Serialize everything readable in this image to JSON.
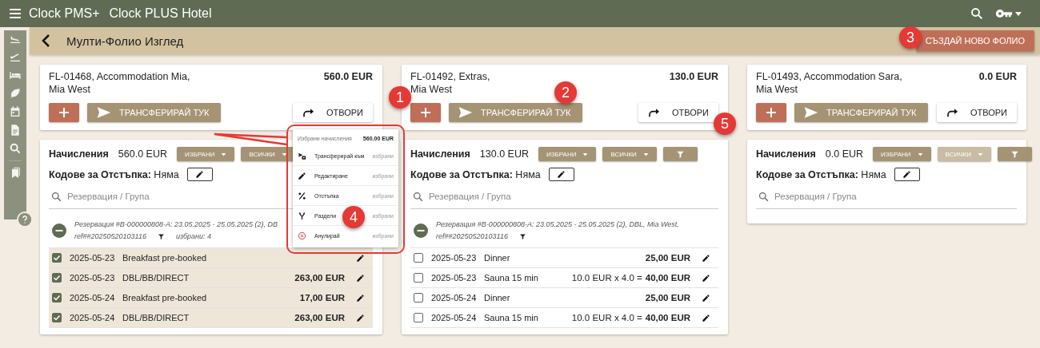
{
  "topbar": {
    "brand": "Clock PMS+",
    "hotel": "Clock PLUS Hotel"
  },
  "subheader": {
    "title": "Мулти-Фолио Изглед",
    "create_button": "СЪЗДАЙ НОВО ФОЛИО"
  },
  "folios": [
    {
      "title": "FL-01468, Accommodation Mia,",
      "guest": "Mia West",
      "total": "560.0 EUR",
      "transfer_button": "ТРАНСФЕРИРАЙ ТУК",
      "open_button": "ОТВОРИ",
      "charges": {
        "label": "Начисления",
        "amount": "560.0 EUR",
        "buttons": [
          {
            "kind": "dropdown",
            "label": "ИЗБРАНИ",
            "disabled": false
          },
          {
            "kind": "dropdown",
            "label": "ВСИЧКИ",
            "disabled": false
          }
        ],
        "discount_label": "Кодове за Отстъпка:",
        "discount_value": "Няма",
        "search_placeholder": "Резервация / Група",
        "group": {
          "title": "Резервация #B-000000808-A: 23.05.2025 - 25.05.2025 (2), DB",
          "ref": "ref##20250520103116",
          "selected_count": "избрани: 4"
        },
        "rows": [
          {
            "checked": true,
            "date": "2025-05-23",
            "name": "Breakfast pre-booked"
          },
          {
            "checked": true,
            "date": "2025-05-23",
            "name": "DBL/BB/DIRECT",
            "amount": "263,00 EUR"
          },
          {
            "checked": true,
            "date": "2025-05-24",
            "name": "Breakfast pre-booked",
            "amount": "17,00 EUR"
          },
          {
            "checked": true,
            "date": "2025-05-24",
            "name": "DBL/BB/DIRECT",
            "amount": "263,00 EUR"
          }
        ]
      }
    },
    {
      "title": "FL-01492, Extras,",
      "guest": "Mia West",
      "total": "130.0 EUR",
      "transfer_button": "ТРАНСФЕРИРАЙ ТУК",
      "open_button": "ОТВОРИ",
      "charges": {
        "label": "Начисления",
        "amount": "130.0 EUR",
        "buttons": [
          {
            "kind": "dropdown",
            "label": "ИЗБРАНИ",
            "disabled": false
          },
          {
            "kind": "dropdown",
            "label": "ВСИЧКИ",
            "disabled": false
          },
          {
            "kind": "filter",
            "disabled": false
          }
        ],
        "discount_label": "Кодове за Отстъпка:",
        "discount_value": "Няма",
        "search_placeholder": "Резервация / Група",
        "group": {
          "title": "Резервация #B-000000808-A: 23.05.2025 - 25.05.2025 (2), DBL, Mia West,",
          "ref": "ref##20250520103116"
        },
        "rows": [
          {
            "checked": false,
            "date": "2025-05-23",
            "name": "Dinner",
            "amount": "25,00 EUR"
          },
          {
            "checked": false,
            "date": "2025-05-23",
            "name": "Sauna 15 min",
            "calc": "10.0 EUR x 4.0 =",
            "amount": "40,00 EUR"
          },
          {
            "checked": false,
            "date": "2025-05-24",
            "name": "Dinner",
            "amount": "25,00 EUR"
          },
          {
            "checked": false,
            "date": "2025-05-24",
            "name": "Sauna 15 min",
            "calc": "10.0 EUR x 4.0 =",
            "amount": "40,00 EUR"
          }
        ]
      }
    },
    {
      "title": "FL-01493, Accommodation Sara,",
      "guest": "Mia West",
      "total": "0.0 EUR",
      "transfer_button": "ТРАНСФЕРИРАЙ ТУК",
      "open_button": "ОТВОРИ",
      "charges": {
        "label": "Начисления",
        "amount": "0.0 EUR",
        "buttons": [
          {
            "kind": "dropdown",
            "label": "ИЗБРАНИ",
            "disabled": false
          },
          {
            "kind": "dropdown",
            "label": "ВСИЧКИ",
            "disabled": true
          },
          {
            "kind": "filter",
            "disabled": false
          }
        ],
        "discount_label": "Кодове за Отстъпка:",
        "discount_value": "Няма",
        "search_placeholder": "Резервация / Група"
      }
    }
  ],
  "selection_menu": {
    "title": "Избрани начисления",
    "total": "560.00 EUR",
    "items": [
      {
        "kind": "transfer",
        "label": "Трансферирай към",
        "scope": "избрани"
      },
      {
        "kind": "edit",
        "label": "Редактиране",
        "scope": "избрани"
      },
      {
        "kind": "discount",
        "label": "Отстъпка",
        "scope": "избрани"
      },
      {
        "kind": "split",
        "label": "Раздели",
        "scope": "избрани"
      },
      {
        "kind": "cancel",
        "label": "Анулирай",
        "scope": "избрани"
      }
    ]
  },
  "annotations": [
    "1",
    "2",
    "3",
    "4",
    "5"
  ]
}
